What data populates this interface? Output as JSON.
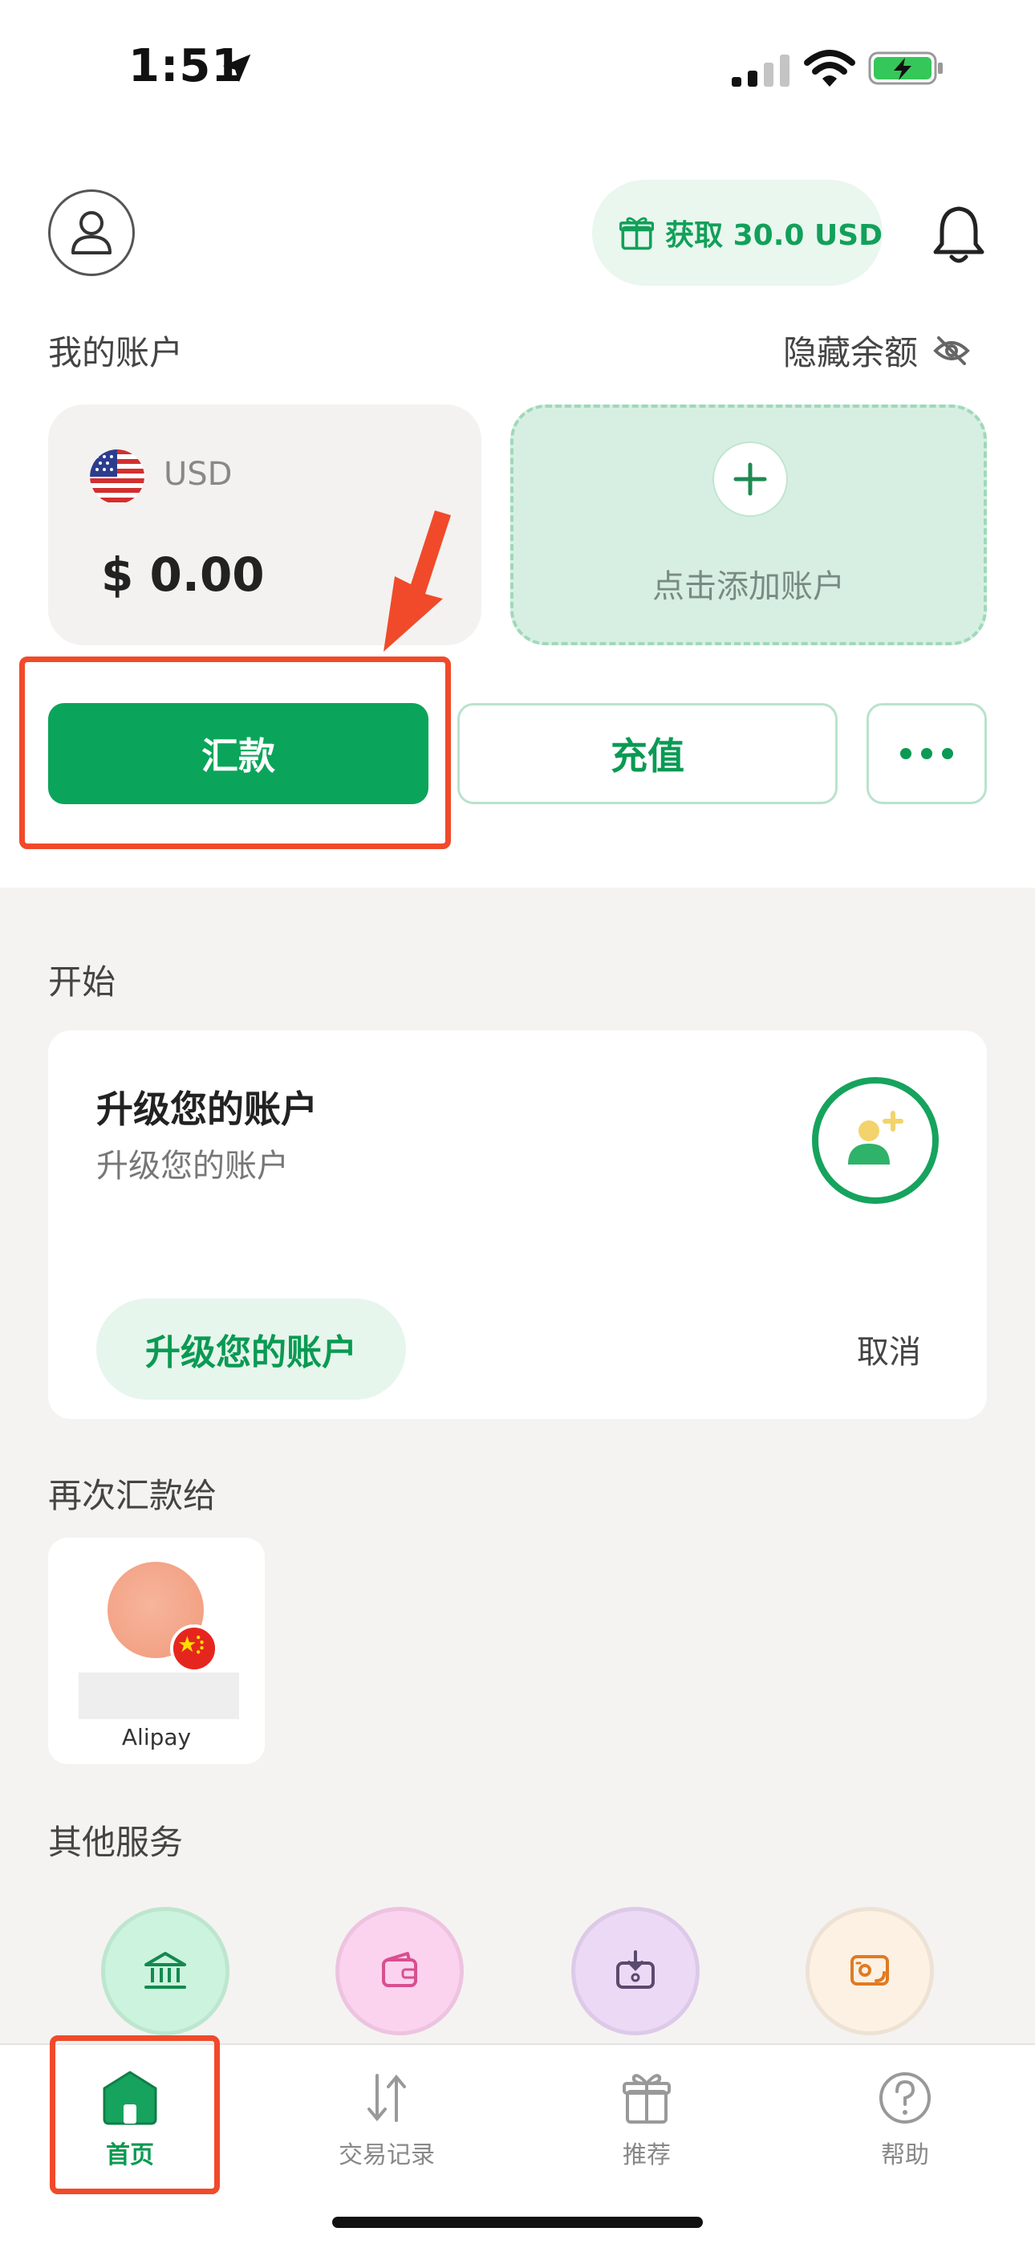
{
  "status_bar": {
    "time": "1:51"
  },
  "header": {
    "reward_label": "获取 30.0 USD"
  },
  "account": {
    "section_title": "我的账户",
    "hide_balance_label": "隐藏余额",
    "usd_card": {
      "currency": "USD",
      "balance": "$ 0.00"
    },
    "add_card_label": "点击添加账户"
  },
  "actions": {
    "send_label": "汇款",
    "topup_label": "充值"
  },
  "getting_started": {
    "section_title": "开始",
    "card_title": "升级您的账户",
    "card_subtitle": "升级您的账户",
    "button_label": "升级您的账户",
    "cancel_label": "取消"
  },
  "send_again": {
    "section_title": "再次汇款给",
    "contacts": [
      {
        "name": "Alipay"
      }
    ]
  },
  "other_services": {
    "section_title": "其他服务",
    "icons": [
      "bank-icon",
      "wallet-icon",
      "receive-icon",
      "exchange-icon"
    ]
  },
  "tab_bar": {
    "tabs": [
      {
        "label": "首页",
        "active": true
      },
      {
        "label": "交易记录",
        "active": false
      },
      {
        "label": "推荐",
        "active": false
      },
      {
        "label": "帮助",
        "active": false
      }
    ]
  },
  "colors": {
    "brand_green": "#0aa55a",
    "annotation_red": "#f04a2a"
  }
}
